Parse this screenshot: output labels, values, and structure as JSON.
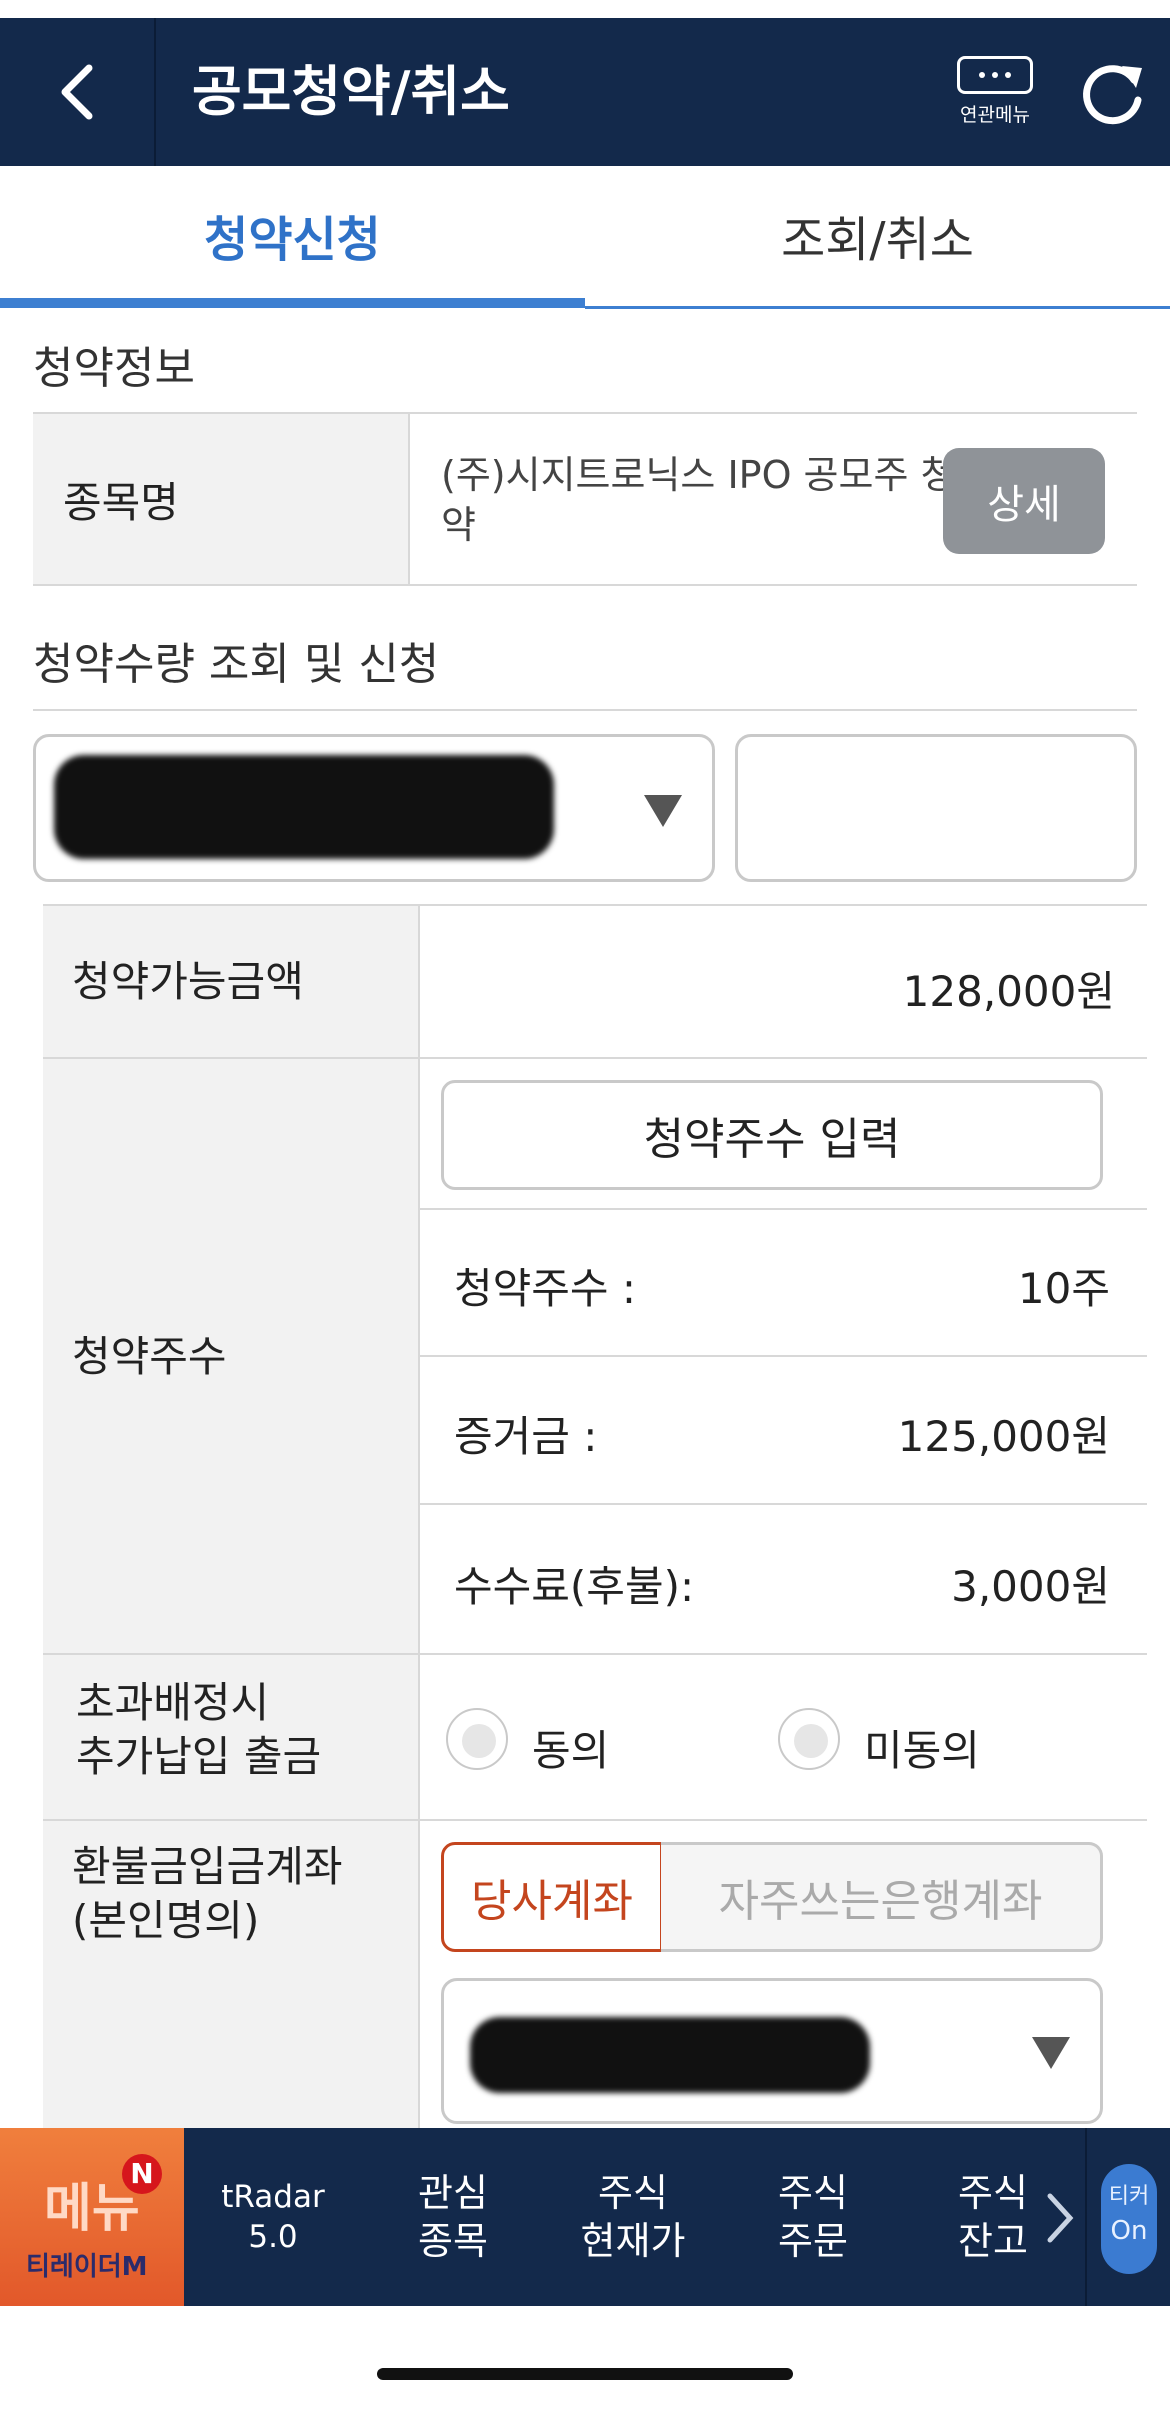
{
  "header": {
    "title": "공모청약/취소",
    "related_menu_label": "연관메뉴"
  },
  "tabs": [
    {
      "label": "청약신청",
      "active": true
    },
    {
      "label": "조회/취소",
      "active": false
    }
  ],
  "subscription_info": {
    "section_title": "청약정보",
    "stock_name_label": "종목명",
    "stock_name_value": "(주)시지트로닉스 IPO 공모주 청약",
    "detail_button": "상세"
  },
  "quantity_section": {
    "section_title": "청약수량 조회 및 신청",
    "available_amount_label": "청약가능금액",
    "available_amount_value": "128,000원",
    "shares_label": "청약주수",
    "enter_shares_button": "청약주수 입력",
    "shares_count_label": "청약주수 :",
    "shares_count_value": "10주",
    "deposit_label": "증거금 :",
    "deposit_value": "125,000원",
    "fee_label": "수수료(후불):",
    "fee_value": "3,000원",
    "over_alloc_label_line1": "초과배정시",
    "over_alloc_label_line2": "추가납입 출금",
    "agree_option": "동의",
    "disagree_option": "미동의",
    "refund_label_line1": "환불금입금계좌",
    "refund_label_line2": "(본인명의)",
    "own_account_button": "당사계좌",
    "bank_account_button": "자주쓰는은행계좌"
  },
  "bottom_nav": {
    "menu_label": "메뉴",
    "menu_badge": "N",
    "brand": "티레이더M",
    "items": [
      {
        "label": "tRadar\n5.0"
      },
      {
        "label": "관심\n종목"
      },
      {
        "label": "주식\n현재가"
      },
      {
        "label": "주식\n주문"
      },
      {
        "label": "주식\n잔고"
      }
    ],
    "ticker_line1": "티커",
    "ticker_line2": "On"
  },
  "colors": {
    "header_bg": "#13294b",
    "tab_active": "#2f72c8",
    "accent_orange": "#c4451e",
    "detail_button_bg": "#8f9398"
  }
}
